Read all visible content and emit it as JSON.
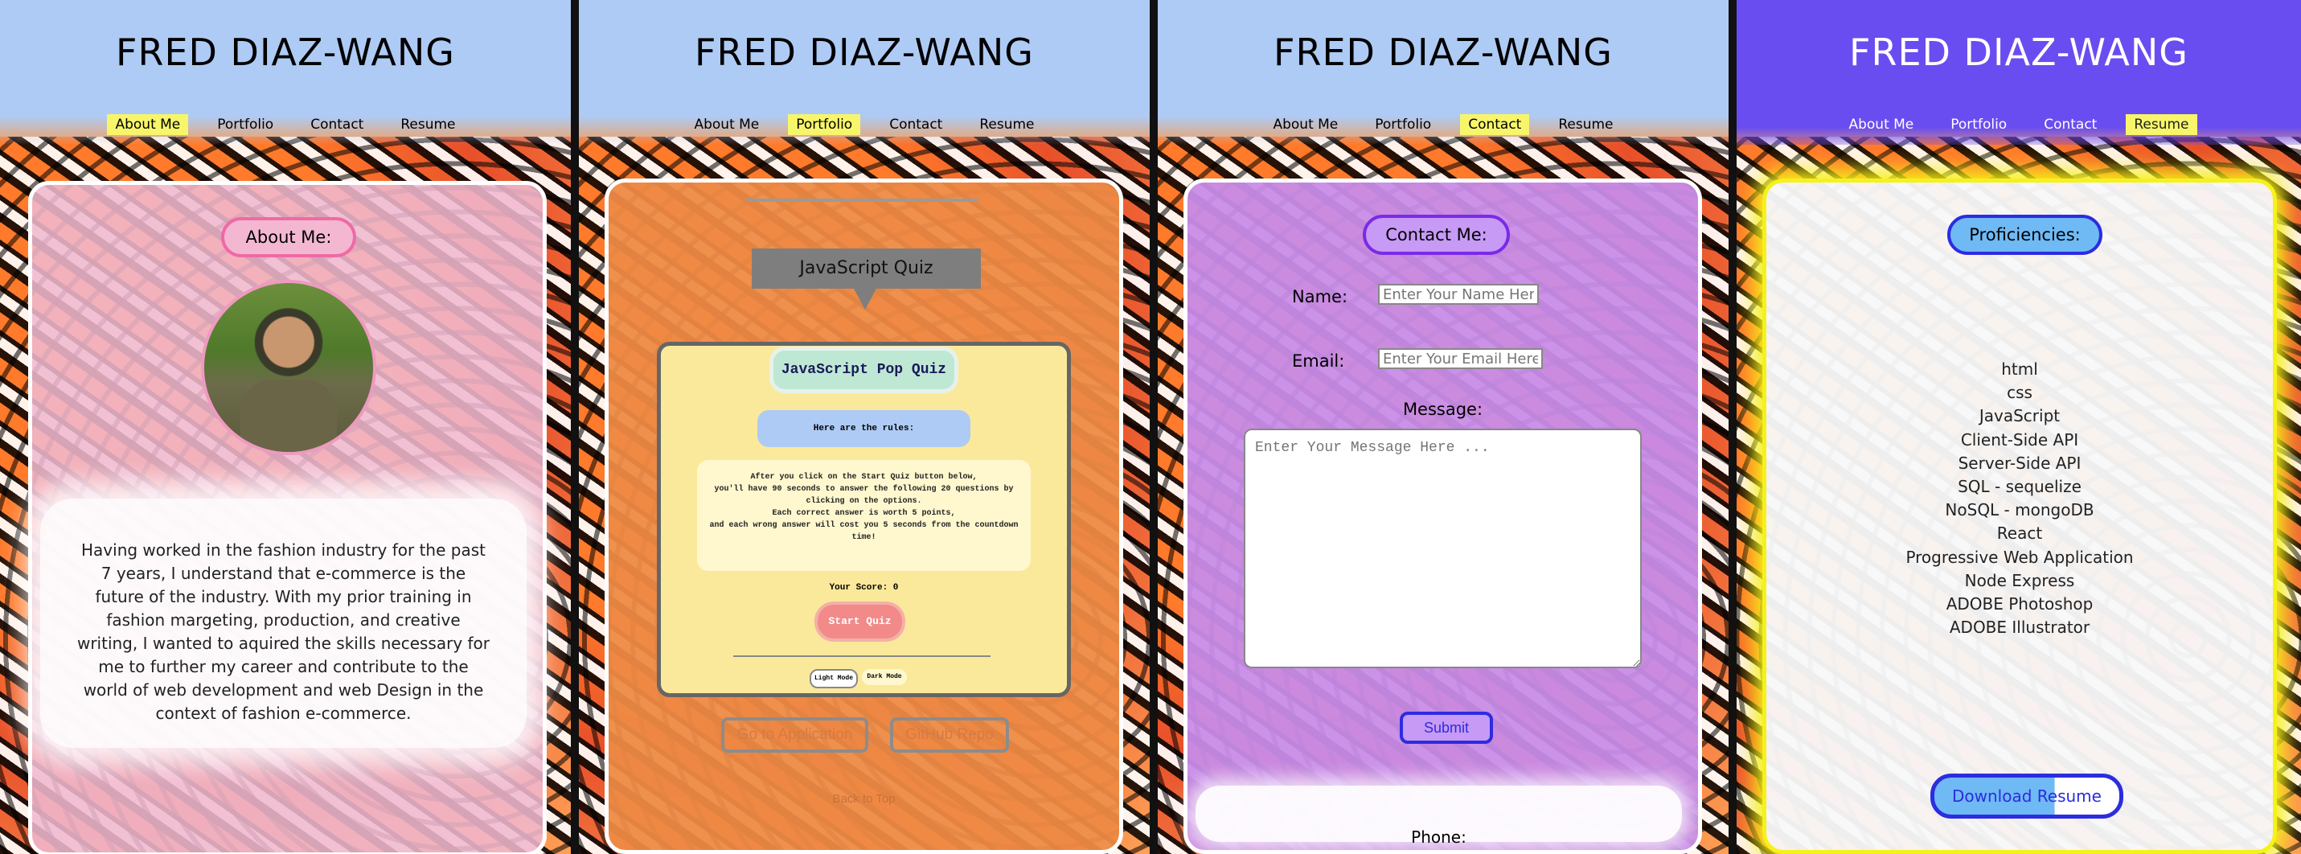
{
  "site_title": "FRED DIAZ-WANG",
  "nav": [
    "About Me",
    "Portfolio",
    "Contact",
    "Resume"
  ],
  "about": {
    "heading": "About Me:",
    "bio": "Having worked in the fashion industry for the past 7 years, I understand that e-commerce is the future of the industry. With my prior training in fashion margeting, production, and creative writing, I wanted to aquired the skills necessary for me to further my career and contribute to the world of web development and web Design in the context of fashion e-commerce."
  },
  "portfolio": {
    "quiz_bubble": "JavaScript Quiz",
    "quiz_title": "JavaScript Pop Quiz",
    "rules_heading": "Here are the rules:",
    "rules_lines": [
      "After you click on the Start Quiz button below,",
      "you'll have 90 seconds to answer the following 20 questions by",
      "clicking on the options.",
      "Each correct answer is worth 5 points,",
      "and each wrong answer will cost you 5 seconds from the countdown",
      "time!"
    ],
    "score": "Your Score: 0",
    "start_button": "Start Quiz",
    "light_mode": "Light Mode",
    "dark_mode": "Dark Mode",
    "app_button": "Go to Application",
    "repo_button": "GitHub Repo",
    "back_to_top": "Back to Top"
  },
  "contact": {
    "heading": "Contact Me:",
    "name_label": "Name:",
    "name_placeholder": "Enter Your Name Here",
    "email_label": "Email:",
    "email_placeholder": "Enter Your Email Here .",
    "message_label": "Message:",
    "message_placeholder": "Enter Your Message Here ...",
    "submit": "Submit",
    "phone_label": "Phone:"
  },
  "resume": {
    "heading": "Proficiencies:",
    "skills": [
      "html",
      "css",
      "JavaScript",
      "Client-Side API",
      "Server-Side API",
      "SQL - sequelize",
      "NoSQL - mongoDB",
      "React",
      "Progressive Web Application",
      "Node Express",
      "ADOBE Photoshop",
      "ADOBE Illustrator"
    ],
    "download": "Download Resume"
  },
  "colors": {
    "header_light": "#aecbf5",
    "header_resume": "#6a4df0",
    "nav_active": "#f7f56a",
    "about_card": "#f0b8cf",
    "about_pill": "#f4b7d2",
    "portfolio_card": "#ee8a45",
    "quiz_panel": "#fbe99b",
    "contact_card": "#c88ce8",
    "contact_pill": "#c79af5",
    "resume_pill": "#6fb9f5",
    "pill_border_blue": "#2c2ce0"
  }
}
